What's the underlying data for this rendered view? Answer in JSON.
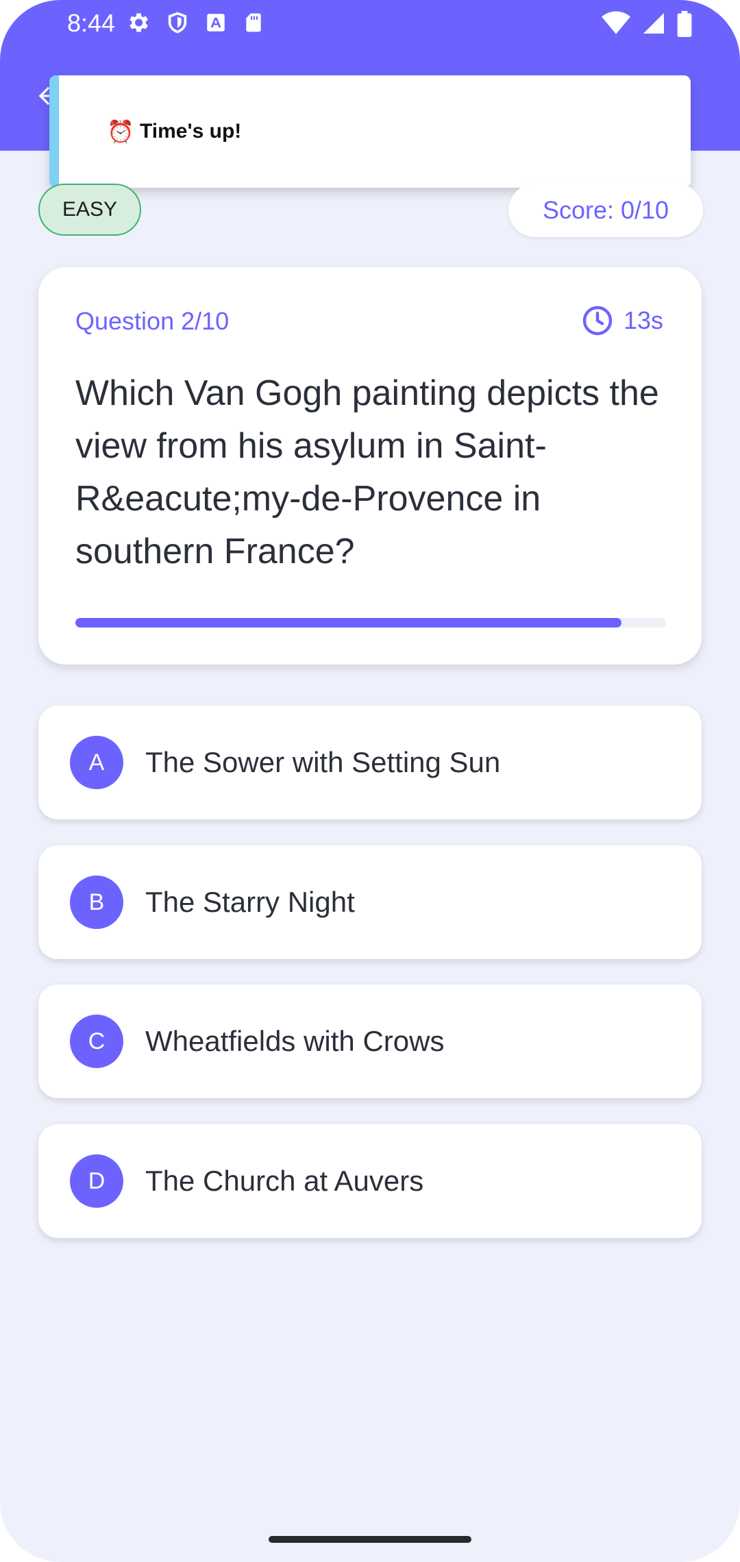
{
  "status_bar": {
    "time": "8:44",
    "left_icons": [
      "gear-icon",
      "shield-icon",
      "font-download-icon",
      "sd-card-icon"
    ],
    "right_icons": [
      "wifi-icon",
      "signal-icon",
      "battery-icon"
    ]
  },
  "app_bar": {
    "title": "",
    "back_icon": "back-arrow-icon"
  },
  "toast": {
    "icon": "⏰",
    "message": "Time's up!"
  },
  "difficulty": "EASY",
  "score": "Score: 0/10",
  "question": {
    "counter": "Question 2/10",
    "timer": "13s",
    "text": "Which Van Gogh painting depicts the view from his asylum in Saint-R&eacute;my-de-Provence in southern France?",
    "progress_fraction": 0.925
  },
  "options": [
    {
      "letter": "A",
      "text": "The Sower with Setting Sun"
    },
    {
      "letter": "B",
      "text": "The Starry Night"
    },
    {
      "letter": "C",
      "text": "Wheatfields with Crows"
    },
    {
      "letter": "D",
      "text": "The Church at Auvers"
    }
  ],
  "colors": {
    "primary": "#6C63FF",
    "background": "#EEF0FB",
    "easy_border": "#3CB371",
    "easy_fill": "#D7EEDF",
    "toast_accent": "#7FD0F5"
  }
}
